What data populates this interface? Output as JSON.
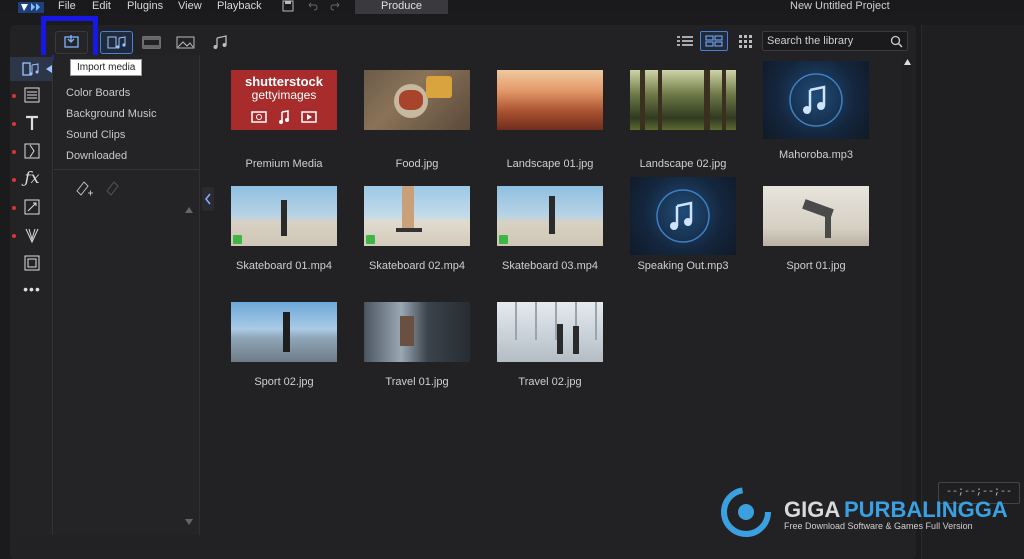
{
  "menu": {
    "items": [
      "File",
      "Edit",
      "Plugins",
      "View",
      "Playback"
    ],
    "produce": "Produce",
    "project_title": "New Untitled Project"
  },
  "tooltip": "Import media",
  "search": {
    "placeholder": "Search the library"
  },
  "categories": [
    "Color Boards",
    "Background Music",
    "Sound Clips",
    "Downloaded"
  ],
  "media": [
    {
      "name": "Premium Media",
      "kind": "premium"
    },
    {
      "name": "Food.jpg",
      "kind": "food"
    },
    {
      "name": "Landscape 01.jpg",
      "kind": "canyon"
    },
    {
      "name": "Landscape 02.jpg",
      "kind": "forest"
    },
    {
      "name": "Mahoroba.mp3",
      "kind": "audio"
    },
    {
      "name": "Skateboard 01.mp4",
      "kind": "video"
    },
    {
      "name": "Skateboard 02.mp4",
      "kind": "video"
    },
    {
      "name": "Skateboard 03.mp4",
      "kind": "video"
    },
    {
      "name": "Speaking Out.mp3",
      "kind": "audio"
    },
    {
      "name": "Sport 01.jpg",
      "kind": "sport1"
    },
    {
      "name": "Sport 02.jpg",
      "kind": "sport2"
    },
    {
      "name": "Travel 01.jpg",
      "kind": "travel1"
    },
    {
      "name": "Travel 02.jpg",
      "kind": "travel2"
    }
  ],
  "premium_logo": {
    "line1": "shutterstock",
    "line2": "gettyimages"
  },
  "watermark": {
    "title_a": "GIGA",
    "title_b": "PURBALINGGA",
    "subtitle": "Free Download Software & Games Full Version"
  },
  "timecode": "--;--;--;--",
  "colors": {
    "accent": "#4d7fd6",
    "highlight": "#1717e6",
    "premium_bg": "#a82c2c"
  }
}
